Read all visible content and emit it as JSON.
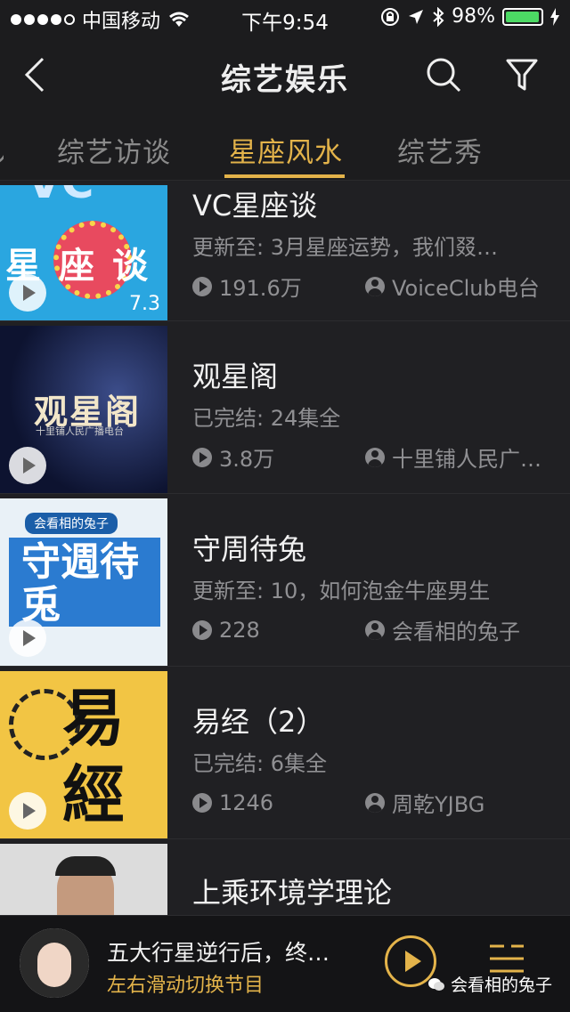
{
  "status_bar": {
    "carrier": "中国移动",
    "time": "下午9:54",
    "battery": "98%",
    "battery_level": 0.98
  },
  "header": {
    "title": "综艺娱乐"
  },
  "tabs": [
    {
      "label": "综艺访谈",
      "active": false
    },
    {
      "label": "星座风水",
      "active": true
    },
    {
      "label": "综艺秀",
      "active": false
    }
  ],
  "items": [
    {
      "title": "VC星座谈",
      "subtitle": "更新至: 3月星座运势，我们叕…",
      "plays": "191.6万",
      "author": "VoiceClub电台",
      "thumb_text": "VC",
      "thumb_badge": "7.3"
    },
    {
      "title": "观星阁",
      "subtitle": "已完结: 24集全",
      "plays": "3.8万",
      "author": "十里铺人民广…",
      "thumb_text": "观星阁",
      "thumb_caption": "十里铺人民广播电台"
    },
    {
      "title": "守周待兔",
      "subtitle": "更新至: 10，如何泡金牛座男生",
      "plays": "228",
      "author": "会看相的兔子",
      "thumb_text": "守週待兎",
      "thumb_tag": "会看相的兔子"
    },
    {
      "title": "易经（2）",
      "subtitle": "已完结: 6集全",
      "plays": "1246",
      "author": "周乾YJBG",
      "thumb_text": "易經"
    },
    {
      "title": "上乘环境学理论",
      "subtitle": "",
      "plays": "",
      "author": ""
    }
  ],
  "player": {
    "title": "五大行星逆行后，终…",
    "hint": "左右滑动切换节目"
  },
  "watermark": "会看相的兔子",
  "colors": {
    "accent": "#e3b34a",
    "background": "#202023"
  }
}
